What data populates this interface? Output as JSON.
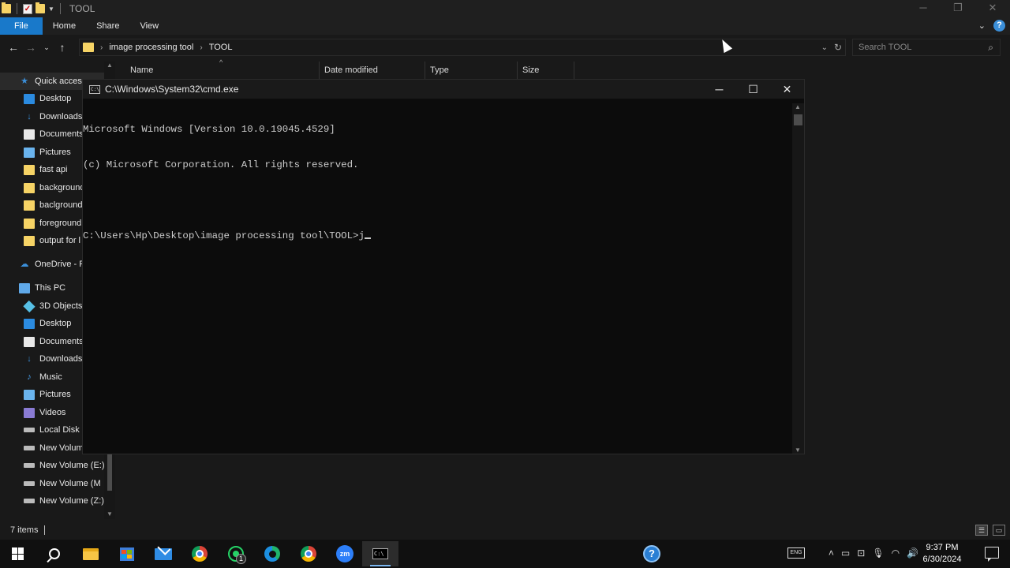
{
  "explorer": {
    "title": "TOOL",
    "ribbon_tabs": [
      "File",
      "Home",
      "Share",
      "View"
    ],
    "breadcrumbs": [
      "image processing tool",
      "TOOL"
    ],
    "search_placeholder": "Search TOOL",
    "columns": [
      "Name",
      "Date modified",
      "Type",
      "Size"
    ],
    "nav_items": [
      {
        "label": "Quick access",
        "icon": "star-icon"
      },
      {
        "label": "Desktop",
        "icon": "desktop-icon"
      },
      {
        "label": "Downloads",
        "icon": "download-icon"
      },
      {
        "label": "Documents",
        "icon": "document-icon"
      },
      {
        "label": "Pictures",
        "icon": "picture-icon"
      },
      {
        "label": "fast api",
        "icon": "folder-icon"
      },
      {
        "label": "background",
        "icon": "folder-icon"
      },
      {
        "label": "baclground",
        "icon": "folder-icon"
      },
      {
        "label": "foreground",
        "icon": "folder-icon"
      },
      {
        "label": "output for l",
        "icon": "folder-icon"
      },
      {
        "label": "OneDrive - P",
        "icon": "cloud-icon"
      },
      {
        "label": "This PC",
        "icon": "pc-icon"
      },
      {
        "label": "3D Objects",
        "icon": "3d-objects-icon"
      },
      {
        "label": "Desktop",
        "icon": "desktop-icon"
      },
      {
        "label": "Documents",
        "icon": "document-icon"
      },
      {
        "label": "Downloads",
        "icon": "download-icon"
      },
      {
        "label": "Music",
        "icon": "music-icon"
      },
      {
        "label": "Pictures",
        "icon": "picture-icon"
      },
      {
        "label": "Videos",
        "icon": "video-icon"
      },
      {
        "label": "Local Disk (",
        "icon": "drive-icon"
      },
      {
        "label": "New Volum",
        "icon": "drive-icon"
      },
      {
        "label": "New Volume (E:)",
        "icon": "drive-icon"
      },
      {
        "label": "New Volume (M",
        "icon": "drive-icon"
      },
      {
        "label": "New Volume (Z:)",
        "icon": "drive-icon"
      }
    ],
    "status_items": "7 items"
  },
  "cmd": {
    "title": "C:\\Windows\\System32\\cmd.exe",
    "icon_text": "C:\\",
    "lines": [
      "Microsoft Windows [Version 10.0.19045.4529]",
      "(c) Microsoft Corporation. All rights reserved.",
      "",
      "C:\\Users\\Hp\\Desktop\\image processing tool\\TOOL>j"
    ]
  },
  "taskbar": {
    "zoom_label": "zm",
    "whatsapp_badge": "1",
    "cmd_icon_text": "C:\\",
    "help_label": "?",
    "time": "9:37 PM",
    "date": "6/30/2024",
    "keyboard_label": "ENG"
  },
  "colors": {
    "file_tab": "#1979ca",
    "window_bg": "#191919",
    "cmd_bg": "#0c0c0c",
    "cmd_text": "#cccccc",
    "folder": "#f6d365"
  }
}
